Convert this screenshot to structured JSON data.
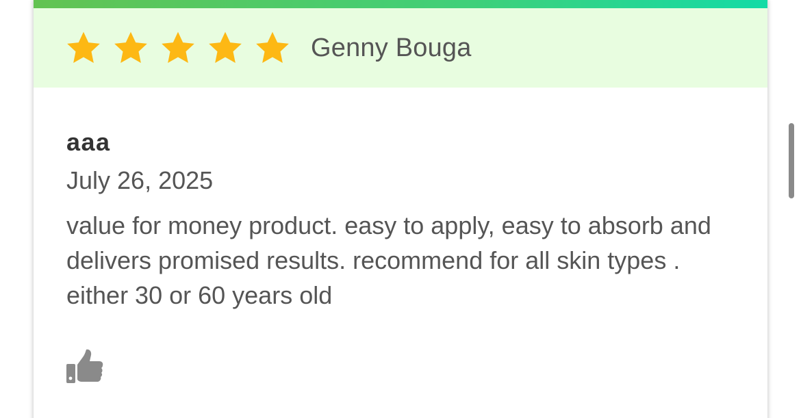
{
  "review": {
    "rating": 5,
    "max_rating": 5,
    "reviewer_name": "Genny Bouga",
    "title": "aaa",
    "date": "July 26, 2025",
    "text": "value for money product. easy to apply, easy to absorb and delivers promised results. recommend for all skin types . either 30 or 60 years old"
  },
  "icons": {
    "star": "star-icon",
    "like": "thumbs-up-icon"
  },
  "colors": {
    "star_fill": "#FDB814",
    "header_bg": "#E8FDE0",
    "gradient_start": "#63C352",
    "gradient_end": "#14DBA6",
    "like_icon": "#8A8A8A"
  }
}
